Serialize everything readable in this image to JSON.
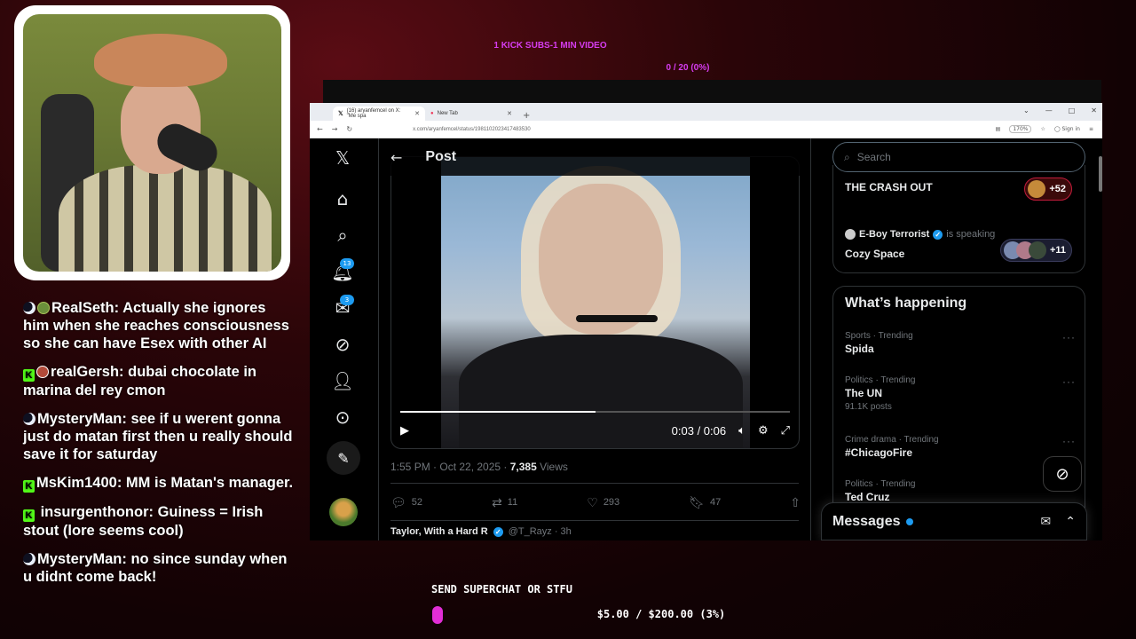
{
  "overlay": {
    "kick_goal": "1 KICK SUBS-1 MIN VIDEO",
    "kick_progress": "0 / 20 (0%)",
    "superchat_label": "SEND SUPERCHAT OR STFU",
    "superchat_progress": "$5.00 / $200.00 (3%)",
    "superchat_fraction": 0.03,
    "accent": "#d63cf0"
  },
  "chat": [
    {
      "badges": [
        "moon",
        "avatar"
      ],
      "user": "RealSeth",
      "text": "Actually she ignores him when she reaches consciousness so she can have Esex with other AI"
    },
    {
      "badges": [
        "kick",
        "avatar2"
      ],
      "user": "realGersh",
      "text": "dubai chocolate in marina del rey cmon"
    },
    {
      "badges": [
        "moon"
      ],
      "user": "MysteryMan",
      "text": "see if u werent gonna just do matan first then u really should save it for saturday"
    },
    {
      "badges": [
        "kick"
      ],
      "user": "MsKim1400",
      "text": "MM is Matan's manager."
    },
    {
      "badges": [
        "kick"
      ],
      "user": " insurgenthonor",
      "text": "Guiness = Irish stout (lore seems cool)"
    },
    {
      "badges": [
        "moon"
      ],
      "user": "MysteryMan",
      "text": "no since sunday when u didnt come back!"
    }
  ],
  "browser": {
    "tabs": [
      {
        "label": "(16) aryanfemcel on X: \"Me spa",
        "active": true
      },
      {
        "label": "New Tab",
        "active": false
      }
    ],
    "url": "x.com/aryanfemcel/status/1981102023417483530",
    "zoom": "170%",
    "sign_in": "Sign in"
  },
  "x": {
    "nav": {
      "notifications_count": "13",
      "messages_count": "3"
    },
    "post": {
      "header_title": "Post",
      "video_time": "0:03 / 0:06",
      "video_progress": 0.5,
      "timestamp": "1:55 PM · Oct 22, 2025 · ",
      "views_count": "7,385",
      "views_label": " Views",
      "replies": "52",
      "reposts": "11",
      "likes": "293",
      "bookmarks": "47",
      "reply_peek_name": "Taylor, With a Hard R",
      "reply_peek_handle": "@T_Rayz · 3h"
    },
    "search_placeholder": "Search",
    "spaces": [
      {
        "title": "THE CRASH OUT",
        "count": "+52"
      },
      {
        "host": "E-Boy Terrorist",
        "status": "is speaking",
        "title": "Cozy Space",
        "count": "+11"
      }
    ],
    "trends_title": "What’s happening",
    "trends": [
      {
        "category": "Sports · Trending",
        "name": "Spida",
        "posts": ""
      },
      {
        "category": "Politics · Trending",
        "name": "The UN",
        "posts": "91.1K posts"
      },
      {
        "category": "Crime drama · Trending",
        "name": "#ChicagoFire",
        "posts": ""
      },
      {
        "category": "Politics · Trending",
        "name": "Ted Cruz",
        "posts": ""
      }
    ],
    "messages_label": "Messages",
    "accent": "#1d9bf0"
  }
}
